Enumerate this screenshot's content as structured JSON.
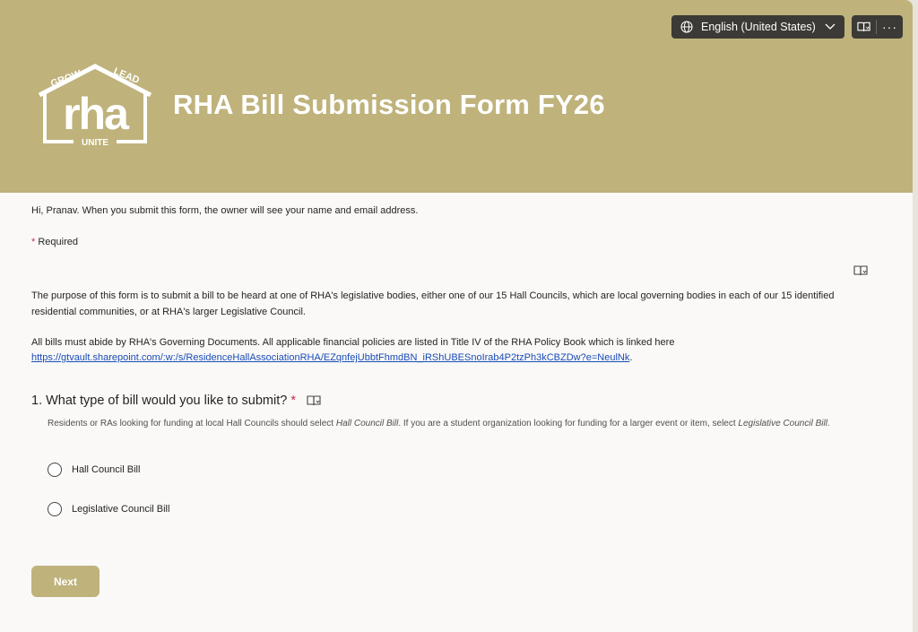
{
  "header": {
    "title": "RHA Bill Submission Form FY26",
    "logo": {
      "top_text": "GROW",
      "top_right_text": "LEAD",
      "main_text": "rha",
      "bottom_text": "UNITE"
    },
    "language_label": "English (United States)",
    "more_label": "···"
  },
  "greeting": "Hi, Pranav. When you submit this form, the owner will see your name and email address.",
  "required": {
    "star": "*",
    "label": "Required"
  },
  "description": {
    "paragraph1": "The purpose of this form is to submit a bill to be heard at one of RHA's legislative bodies, either one of our 15 Hall Councils, which are local governing bodies in each of our 15 identified residential communities, or at RHA's larger Legislative Council.",
    "paragraph2": "All bills must abide by RHA's Governing Documents. All applicable financial policies are listed in Title IV of the RHA Policy Book which is linked here",
    "link": "https://gtvault.sharepoint.com/:w:/s/ResidenceHallAssociationRHA/EZqnfejUbbtFhmdBN_iRShUBESnoIrab4P2tzPh3kCBZDw?e=NeulNk",
    "link_suffix": "."
  },
  "question1": {
    "title": "1. What type of bill would you like to submit?",
    "star": "*",
    "help_pre": "Residents or RAs looking for funding at local Hall Councils should select ",
    "help_em1": "Hall Council Bill",
    "help_mid": ". If you are a student organization looking for funding for a larger event or item, select ",
    "help_em2": "Legislative Council Bill",
    "help_post": ".",
    "options": [
      "Hall Council Bill",
      "Legislative Council Bill"
    ]
  },
  "next_label": "Next",
  "colors": {
    "brand": "#bfb27b",
    "required": "#c4314b",
    "link": "#1a4cb8",
    "button_dark": "#3b3a36"
  },
  "icons": [
    "globe-icon",
    "chevron-down-icon",
    "immersive-reader-icon",
    "more-icon"
  ]
}
